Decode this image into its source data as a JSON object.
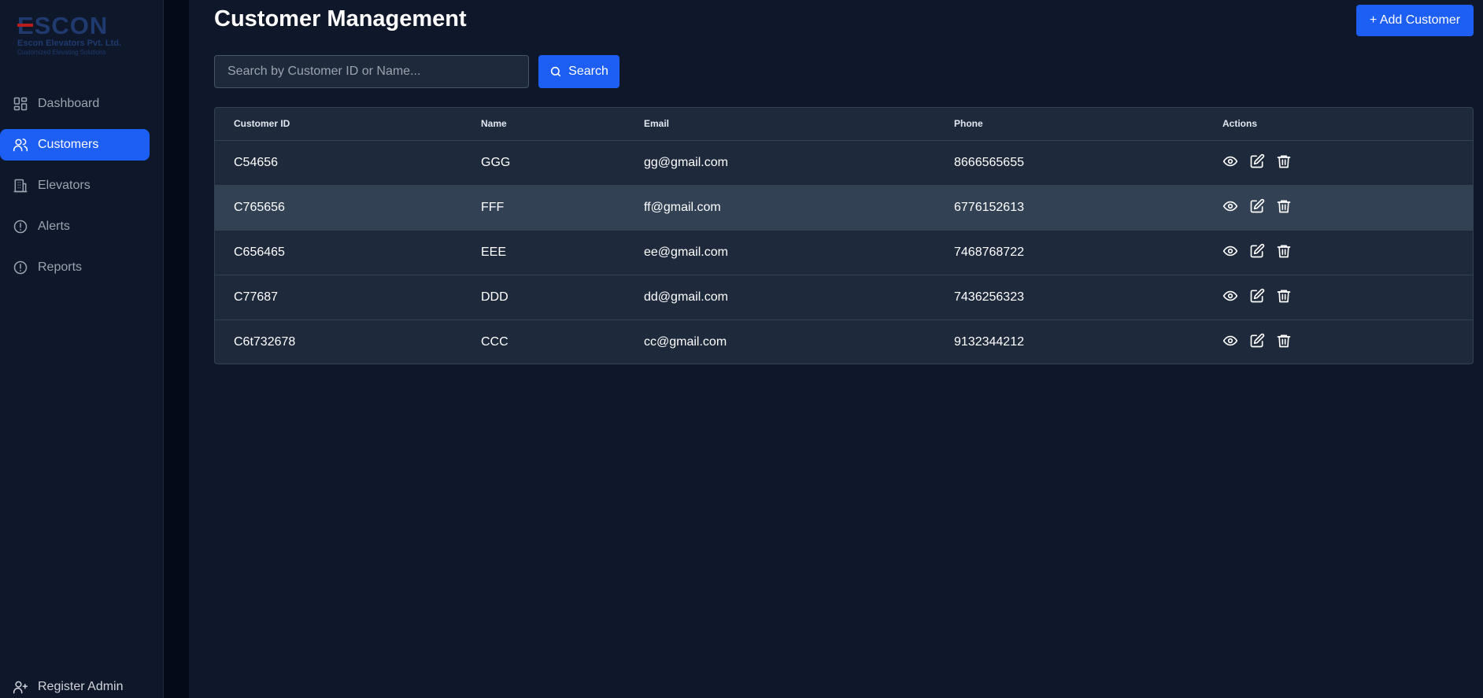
{
  "brand": {
    "name": "ESCON",
    "company": "Escon Elevators Pvt. Ltd.",
    "tagline": "Customized Elevating Solutions"
  },
  "sidebar": {
    "items": [
      {
        "label": "Dashboard",
        "icon": "dashboard-icon"
      },
      {
        "label": "Customers",
        "icon": "users-icon",
        "active": true
      },
      {
        "label": "Elevators",
        "icon": "building-icon"
      },
      {
        "label": "Alerts",
        "icon": "alert-circle-icon"
      },
      {
        "label": "Reports",
        "icon": "alert-circle-icon"
      }
    ],
    "footer_item": {
      "label": "Register Admin",
      "icon": "user-plus-icon"
    }
  },
  "header": {
    "title": "Customer Management",
    "add_label": "+ Add Customer"
  },
  "search": {
    "placeholder": "Search by Customer ID or Name...",
    "button_label": "Search"
  },
  "table": {
    "columns": [
      "Customer ID",
      "Name",
      "Email",
      "Phone",
      "Actions"
    ],
    "rows": [
      {
        "id": "C54656",
        "name": "GGG",
        "email": "gg@gmail.com",
        "phone": "8666565655"
      },
      {
        "id": "C765656",
        "name": "FFF",
        "email": "ff@gmail.com",
        "phone": "6776152613"
      },
      {
        "id": "C656465",
        "name": "EEE",
        "email": "ee@gmail.com",
        "phone": "7468768722"
      },
      {
        "id": "C77687",
        "name": "DDD",
        "email": "dd@gmail.com",
        "phone": "7436256323"
      },
      {
        "id": "C6t732678",
        "name": "CCC",
        "email": "cc@gmail.com",
        "phone": "9132344212"
      }
    ]
  },
  "colors": {
    "accent": "#1d5ff5",
    "background": "#0f172a",
    "surface": "#1e293b",
    "border": "#334155"
  }
}
